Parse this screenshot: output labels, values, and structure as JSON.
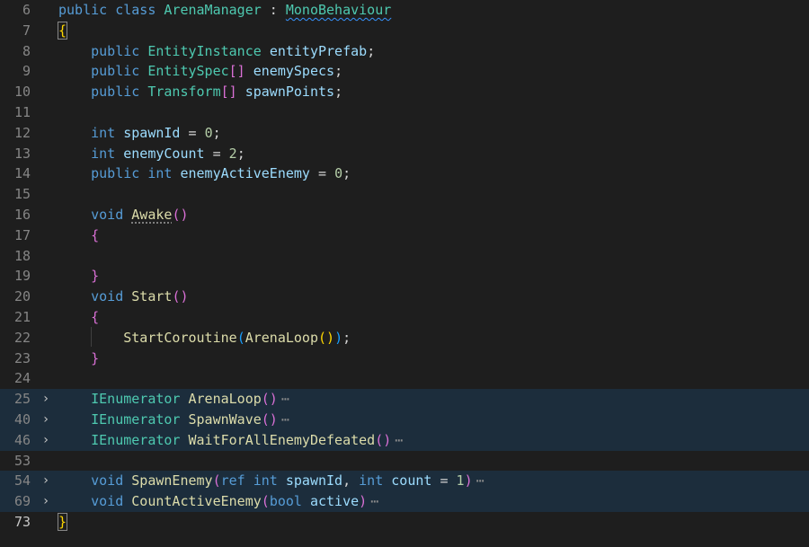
{
  "editor": {
    "lines": [
      {
        "num": "6",
        "folded": false,
        "current": false,
        "tokens": [
          {
            "t": "public",
            "c": "kw"
          },
          {
            "t": " "
          },
          {
            "t": "class",
            "c": "kw"
          },
          {
            "t": " "
          },
          {
            "t": "ArenaManager",
            "c": "type"
          },
          {
            "t": " : "
          },
          {
            "t": "MonoBehaviour",
            "c": "type squiggle"
          }
        ]
      },
      {
        "num": "7",
        "folded": false,
        "current": false,
        "tokens": [
          {
            "t": "{",
            "c": "br1 bracket-box"
          }
        ]
      },
      {
        "num": "8",
        "folded": false,
        "current": false,
        "tokens": [
          {
            "t": "    "
          },
          {
            "t": "public",
            "c": "kw"
          },
          {
            "t": " "
          },
          {
            "t": "EntityInstance",
            "c": "type"
          },
          {
            "t": " "
          },
          {
            "t": "entityPrefab",
            "c": "var"
          },
          {
            "t": ";"
          }
        ]
      },
      {
        "num": "9",
        "folded": false,
        "current": false,
        "tokens": [
          {
            "t": "    "
          },
          {
            "t": "public",
            "c": "kw"
          },
          {
            "t": " "
          },
          {
            "t": "EntitySpec",
            "c": "type"
          },
          {
            "t": "[]",
            "c": "br2"
          },
          {
            "t": " "
          },
          {
            "t": "enemySpecs",
            "c": "var"
          },
          {
            "t": ";"
          }
        ]
      },
      {
        "num": "10",
        "folded": false,
        "current": false,
        "tokens": [
          {
            "t": "    "
          },
          {
            "t": "public",
            "c": "kw"
          },
          {
            "t": " "
          },
          {
            "t": "Transform",
            "c": "type"
          },
          {
            "t": "[]",
            "c": "br2"
          },
          {
            "t": " "
          },
          {
            "t": "spawnPoints",
            "c": "var"
          },
          {
            "t": ";"
          }
        ]
      },
      {
        "num": "11",
        "folded": false,
        "current": false,
        "tokens": []
      },
      {
        "num": "12",
        "folded": false,
        "current": false,
        "tokens": [
          {
            "t": "    "
          },
          {
            "t": "int",
            "c": "kw"
          },
          {
            "t": " "
          },
          {
            "t": "spawnId",
            "c": "var"
          },
          {
            "t": " = "
          },
          {
            "t": "0",
            "c": "num"
          },
          {
            "t": ";"
          }
        ]
      },
      {
        "num": "13",
        "folded": false,
        "current": false,
        "tokens": [
          {
            "t": "    "
          },
          {
            "t": "int",
            "c": "kw"
          },
          {
            "t": " "
          },
          {
            "t": "enemyCount",
            "c": "var"
          },
          {
            "t": " = "
          },
          {
            "t": "2",
            "c": "num"
          },
          {
            "t": ";"
          }
        ]
      },
      {
        "num": "14",
        "folded": false,
        "current": false,
        "tokens": [
          {
            "t": "    "
          },
          {
            "t": "public",
            "c": "kw"
          },
          {
            "t": " "
          },
          {
            "t": "int",
            "c": "kw"
          },
          {
            "t": " "
          },
          {
            "t": "enemyActiveEnemy",
            "c": "var"
          },
          {
            "t": " = "
          },
          {
            "t": "0",
            "c": "num"
          },
          {
            "t": ";"
          }
        ]
      },
      {
        "num": "15",
        "folded": false,
        "current": false,
        "tokens": []
      },
      {
        "num": "16",
        "folded": false,
        "current": false,
        "tokens": [
          {
            "t": "    "
          },
          {
            "t": "void",
            "c": "kw"
          },
          {
            "t": " "
          },
          {
            "t": "Awake",
            "c": "fn dots-under"
          },
          {
            "t": "()",
            "c": "br2"
          }
        ]
      },
      {
        "num": "17",
        "folded": false,
        "current": false,
        "tokens": [
          {
            "t": "    "
          },
          {
            "t": "{",
            "c": "br2"
          }
        ]
      },
      {
        "num": "18",
        "folded": false,
        "current": false,
        "tokens": []
      },
      {
        "num": "19",
        "folded": false,
        "current": false,
        "tokens": [
          {
            "t": "    "
          },
          {
            "t": "}",
            "c": "br2"
          }
        ]
      },
      {
        "num": "20",
        "folded": false,
        "current": false,
        "tokens": [
          {
            "t": "    "
          },
          {
            "t": "void",
            "c": "kw"
          },
          {
            "t": " "
          },
          {
            "t": "Start",
            "c": "fn"
          },
          {
            "t": "()",
            "c": "br2"
          }
        ]
      },
      {
        "num": "21",
        "folded": false,
        "current": false,
        "tokens": [
          {
            "t": "    "
          },
          {
            "t": "{",
            "c": "br2"
          }
        ]
      },
      {
        "num": "22",
        "folded": false,
        "current": false,
        "tokens": [
          {
            "t": "        "
          },
          {
            "t": "StartCoroutine",
            "c": "fn"
          },
          {
            "t": "(",
            "c": "br3"
          },
          {
            "t": "ArenaLoop",
            "c": "fn"
          },
          {
            "t": "()",
            "c": "br1"
          },
          {
            "t": ")",
            "c": "br3"
          },
          {
            "t": ";"
          }
        ]
      },
      {
        "num": "23",
        "folded": false,
        "current": false,
        "tokens": [
          {
            "t": "    "
          },
          {
            "t": "}",
            "c": "br2"
          }
        ]
      },
      {
        "num": "24",
        "folded": false,
        "current": false,
        "tokens": []
      },
      {
        "num": "25",
        "folded": true,
        "current": false,
        "tokens": [
          {
            "t": "    "
          },
          {
            "t": "IEnumerator",
            "c": "type"
          },
          {
            "t": " "
          },
          {
            "t": "ArenaLoop",
            "c": "fn"
          },
          {
            "t": "()",
            "c": "br2"
          },
          {
            "t": "⋯",
            "c": "ellipsis"
          }
        ]
      },
      {
        "num": "40",
        "folded": true,
        "current": false,
        "tokens": [
          {
            "t": "    "
          },
          {
            "t": "IEnumerator",
            "c": "type"
          },
          {
            "t": " "
          },
          {
            "t": "SpawnWave",
            "c": "fn"
          },
          {
            "t": "()",
            "c": "br2"
          },
          {
            "t": "⋯",
            "c": "ellipsis"
          }
        ]
      },
      {
        "num": "46",
        "folded": true,
        "current": false,
        "tokens": [
          {
            "t": "    "
          },
          {
            "t": "IEnumerator",
            "c": "type"
          },
          {
            "t": " "
          },
          {
            "t": "WaitForAllEnemyDefeated",
            "c": "fn"
          },
          {
            "t": "()",
            "c": "br2"
          },
          {
            "t": "⋯",
            "c": "ellipsis"
          }
        ]
      },
      {
        "num": "53",
        "folded": false,
        "current": false,
        "tokens": []
      },
      {
        "num": "54",
        "folded": true,
        "current": false,
        "tokens": [
          {
            "t": "    "
          },
          {
            "t": "void",
            "c": "kw"
          },
          {
            "t": " "
          },
          {
            "t": "SpawnEnemy",
            "c": "fn"
          },
          {
            "t": "(",
            "c": "br2"
          },
          {
            "t": "ref",
            "c": "kw"
          },
          {
            "t": " "
          },
          {
            "t": "int",
            "c": "kw"
          },
          {
            "t": " "
          },
          {
            "t": "spawnId",
            "c": "var"
          },
          {
            "t": ", "
          },
          {
            "t": "int",
            "c": "kw"
          },
          {
            "t": " "
          },
          {
            "t": "count",
            "c": "var"
          },
          {
            "t": " = "
          },
          {
            "t": "1",
            "c": "num"
          },
          {
            "t": ")",
            "c": "br2"
          },
          {
            "t": "⋯",
            "c": "ellipsis"
          }
        ]
      },
      {
        "num": "69",
        "folded": true,
        "current": false,
        "tokens": [
          {
            "t": "    "
          },
          {
            "t": "void",
            "c": "kw"
          },
          {
            "t": " "
          },
          {
            "t": "CountActiveEnemy",
            "c": "fn"
          },
          {
            "t": "(",
            "c": "br2"
          },
          {
            "t": "bool",
            "c": "kw"
          },
          {
            "t": " "
          },
          {
            "t": "active",
            "c": "var"
          },
          {
            "t": ")",
            "c": "br2"
          },
          {
            "t": "⋯",
            "c": "ellipsis"
          }
        ]
      },
      {
        "num": "73",
        "folded": false,
        "current": true,
        "tokens": [
          {
            "t": "}",
            "c": "br1 bracket-box"
          }
        ]
      }
    ],
    "fold_glyph": "›",
    "colors": {
      "background": "#1e1e1e",
      "folded_line_bg": "#1c2d3c",
      "keyword": "#569cd6",
      "type": "#4ec9b0",
      "function": "#dcdcaa",
      "variable": "#9cdcfe",
      "number": "#b5cea8",
      "bracket_gold": "#ffd700",
      "bracket_orchid": "#da70d6",
      "bracket_blue": "#179fff"
    }
  }
}
